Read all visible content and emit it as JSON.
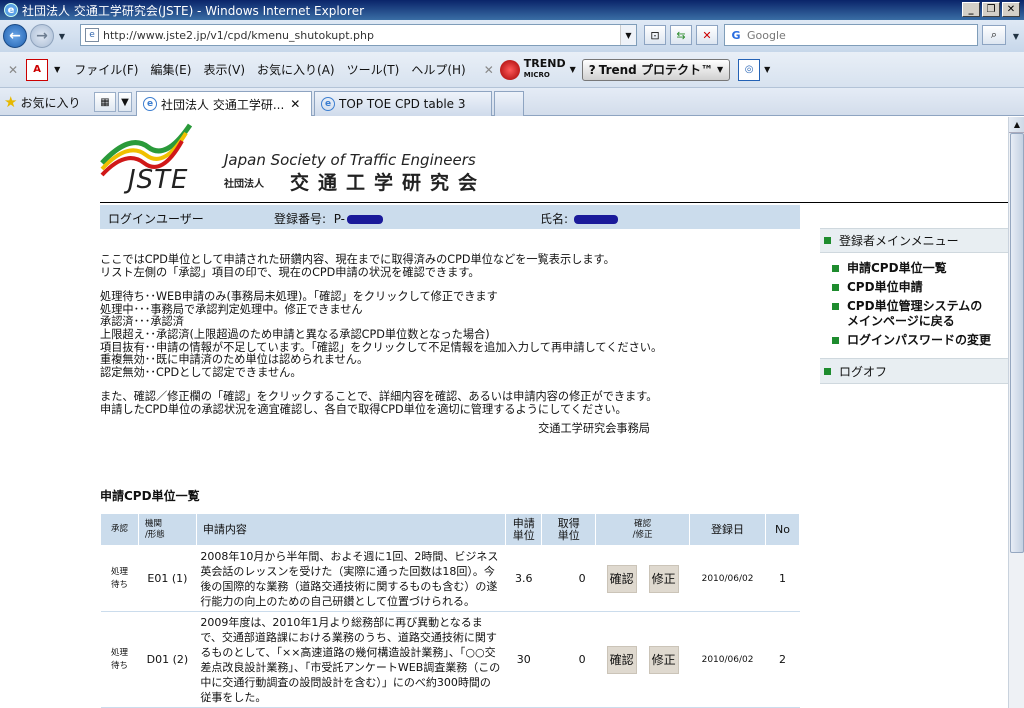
{
  "window": {
    "title": "社団法人 交通工学研究会(JSTE) - Windows Internet Explorer"
  },
  "address_bar": {
    "url": "http://www.jste2.jp/v1/cpd/kmenu_shutokupt.php",
    "search_placeholder": "Google"
  },
  "menubar": {
    "items": [
      "ファイル(F)",
      "編集(E)",
      "表示(V)",
      "お気に入り(A)",
      "ツール(T)",
      "ヘルプ(H)"
    ],
    "trend_line1": "TREND",
    "trend_line2": "MICRO",
    "protect_label": "Trend プロテクト™"
  },
  "tabs": {
    "favorites_label": "お気に入り",
    "items": [
      {
        "label": "社団法人 交通工学研..."
      },
      {
        "label": "TOP TOE CPD table 3"
      }
    ]
  },
  "header": {
    "logo_text": "JSTE",
    "org_en": "Japan Society of Traffic Engineers",
    "org_prefix": "社団法人",
    "org_jp": "交通工学研究会"
  },
  "login_bar": {
    "user_label": "ログインユーザー",
    "reg_label": "登録番号:",
    "reg_value": "P-",
    "name_label": "氏名:"
  },
  "info": {
    "lines1": [
      "ここではCPD単位として申請された研鑽内容、現在までに取得済みのCPD単位などを一覧表示します。",
      "リスト左側の「承認」項目の印で、現在のCPD申請の状況を確認できます。"
    ],
    "lines2": [
      "処理待ち･･WEB申請のみ(事務局未処理)。「確認」をクリックして修正できます",
      "処理中･･･事務局で承認判定処理中。修正できません",
      "承認済･･･承認済",
      "上限超え･･承認済(上限超過のため申請と異なる承認CPD単位数となった場合)",
      "項目抜有･･申請の情報が不足しています。「確認」をクリックして不足情報を追加入力して再申請してください。",
      "重複無効･･既に申請済のため単位は認められません。",
      "認定無効･･CPDとして認定できません。"
    ],
    "lines3": [
      "また、確認／修正欄の「確認」をクリックすることで、詳細内容を確認、あるいは申請内容の修正ができます。",
      "申請したCPD単位の承認状況を適宜確認し、各自で取得CPD単位を適切に管理するようにしてください。"
    ],
    "signer": "交通工学研究会事務局"
  },
  "menu": {
    "head": "登録者メインメニュー",
    "items": [
      "申請CPD単位一覧",
      "CPD単位申請",
      "CPD単位管理システムの",
      "メインページに戻る",
      "ログインパスワードの変更"
    ],
    "logout": "ログオフ"
  },
  "table": {
    "title": "申請CPD単位一覧",
    "headers": {
      "status": "承認",
      "form1": "機関",
      "form2": "/形態",
      "content": "申請内容",
      "apply1": "申請",
      "apply2": "単位",
      "got1": "取得",
      "got2": "単位",
      "confirm1": "確認",
      "confirm2": "/修正",
      "date": "登録日",
      "no": "No"
    },
    "rows": [
      {
        "status1": "処理",
        "status2": "待ち",
        "code": "E01 (1)",
        "content": "2008年10月から半年間、およそ週に1回、2時間、ビジネス英会話のレッスンを受けた（実際に通った回数は18回）。今後の国際的な業務（道路交通技術に関するものも含む）の遂行能力の向上のための自己研鑽として位置づけられる。",
        "apply": "3.6",
        "got": "0",
        "confirm_label": "確認",
        "edit_label": "修正",
        "date": "2010/06/02",
        "no": "1"
      },
      {
        "status1": "処理",
        "status2": "待ち",
        "code": "D01 (2)",
        "content": "2009年度は、2010年1月より総務部に再び異動となるまで、交通部道路課における業務のうち、道路交通技術に関するものとして、「××高速道路の幾何構造設計業務」、「○○交差点改良設計業務」、「市受託アンケートWEB調査業務（この中に交通行動調査の設問設計を含む）」にのべ約300時間の従事をした。",
        "apply": "30",
        "got": "0",
        "confirm_label": "確認",
        "edit_label": "修正",
        "date": "2010/06/02",
        "no": "2"
      }
    ]
  }
}
